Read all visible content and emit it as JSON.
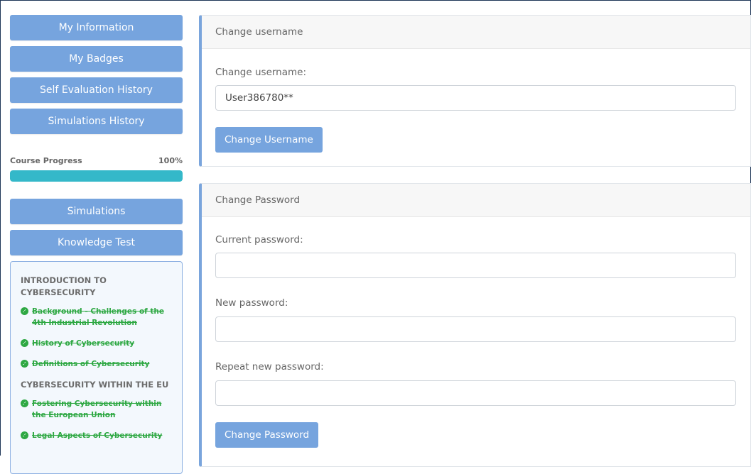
{
  "sidebar": {
    "buttons": [
      {
        "label": "My Information"
      },
      {
        "label": "My Badges"
      },
      {
        "label": "Self Evaluation History"
      },
      {
        "label": "Simulations History"
      }
    ],
    "progress": {
      "label": "Course Progress",
      "value_text": "100%",
      "fraction": 1.0,
      "color": "#34b8c9"
    },
    "buttons2": [
      {
        "label": "Simulations"
      },
      {
        "label": "Knowledge Test"
      }
    ],
    "toc": {
      "sections": [
        {
          "title": "INTRODUCTION TO CYBERSECURITY",
          "items": [
            "Background - Challenges of the 4th Industrial Revolution",
            "History of Cybersecurity",
            "Definitions of Cybersecurity"
          ]
        },
        {
          "title": "CYBERSECURITY WITHIN THE EU",
          "items": [
            "Fostering Cybersecurity within the European Union",
            "Legal Aspects of Cybersecurity"
          ]
        }
      ]
    }
  },
  "username_panel": {
    "header": "Change username",
    "label": "Change username:",
    "value": "User386780**",
    "button": "Change Username"
  },
  "password_panel": {
    "header": "Change Password",
    "current_label": "Current password:",
    "new_label": "New password:",
    "repeat_label": "Repeat new password:",
    "button": "Change Password"
  },
  "colors": {
    "accent": "#76a4de",
    "completed": "#2ea843",
    "progress": "#34b8c9"
  }
}
